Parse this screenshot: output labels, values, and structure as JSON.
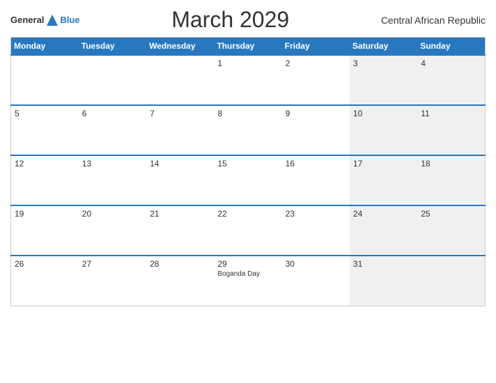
{
  "header": {
    "logo_general": "General",
    "logo_blue": "Blue",
    "title": "March 2029",
    "subtitle": "Central African Republic"
  },
  "calendar": {
    "days_header": [
      "Monday",
      "Tuesday",
      "Wednesday",
      "Thursday",
      "Friday",
      "Saturday",
      "Sunday"
    ],
    "weeks": [
      [
        {
          "day": "",
          "event": ""
        },
        {
          "day": "",
          "event": ""
        },
        {
          "day": "",
          "event": ""
        },
        {
          "day": "1",
          "event": ""
        },
        {
          "day": "2",
          "event": ""
        },
        {
          "day": "3",
          "event": ""
        },
        {
          "day": "4",
          "event": ""
        }
      ],
      [
        {
          "day": "5",
          "event": ""
        },
        {
          "day": "6",
          "event": ""
        },
        {
          "day": "7",
          "event": ""
        },
        {
          "day": "8",
          "event": ""
        },
        {
          "day": "9",
          "event": ""
        },
        {
          "day": "10",
          "event": ""
        },
        {
          "day": "11",
          "event": ""
        }
      ],
      [
        {
          "day": "12",
          "event": ""
        },
        {
          "day": "13",
          "event": ""
        },
        {
          "day": "14",
          "event": ""
        },
        {
          "day": "15",
          "event": ""
        },
        {
          "day": "16",
          "event": ""
        },
        {
          "day": "17",
          "event": ""
        },
        {
          "day": "18",
          "event": ""
        }
      ],
      [
        {
          "day": "19",
          "event": ""
        },
        {
          "day": "20",
          "event": ""
        },
        {
          "day": "21",
          "event": ""
        },
        {
          "day": "22",
          "event": ""
        },
        {
          "day": "23",
          "event": ""
        },
        {
          "day": "24",
          "event": ""
        },
        {
          "day": "25",
          "event": ""
        }
      ],
      [
        {
          "day": "26",
          "event": ""
        },
        {
          "day": "27",
          "event": ""
        },
        {
          "day": "28",
          "event": ""
        },
        {
          "day": "29",
          "event": "Boganda Day"
        },
        {
          "day": "30",
          "event": ""
        },
        {
          "day": "31",
          "event": ""
        },
        {
          "day": "",
          "event": ""
        }
      ]
    ]
  }
}
